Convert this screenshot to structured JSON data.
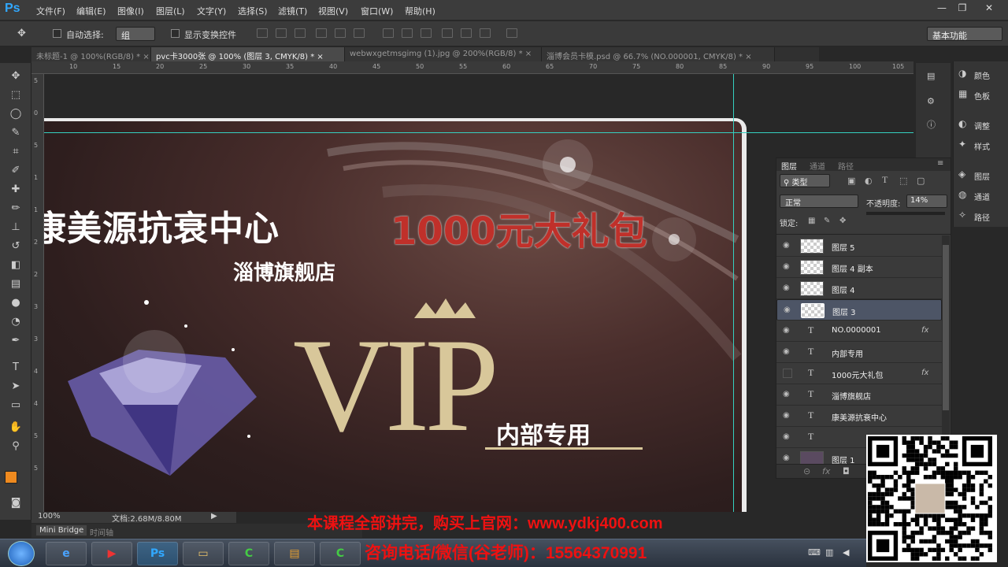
{
  "app": {
    "logo": "Ps"
  },
  "menu": [
    "文件(F)",
    "编辑(E)",
    "图像(I)",
    "图层(L)",
    "文字(Y)",
    "选择(S)",
    "滤镜(T)",
    "视图(V)",
    "窗口(W)",
    "帮助(H)"
  ],
  "window_controls": {
    "minimize": "—",
    "restore": "❐",
    "close": "✕"
  },
  "options": {
    "auto_select_label": "自动选择:",
    "auto_select_value": "组",
    "show_transform_label": "显示变换控件",
    "workspace": "基本功能"
  },
  "tabs": [
    {
      "label": "未标题-1 @ 100%(RGB/8) *",
      "close": "×"
    },
    {
      "label": "pvc卡3000张 @ 100% (图层 3, CMYK/8) *",
      "close": "×"
    },
    {
      "label": "webwxgetmsgimg (1).jpg @ 200%(RGB/8) *",
      "close": "×"
    },
    {
      "label": "淄博会员卡模.psd @ 66.7% (NO.000001, CMYK/8) *",
      "close": "×"
    }
  ],
  "ruler_top": [
    "10",
    "15",
    "20",
    "25",
    "30",
    "35",
    "40",
    "45",
    "50",
    "55",
    "60",
    "65",
    "70",
    "75",
    "80",
    "85",
    "90",
    "95",
    "100",
    "105"
  ],
  "ruler_left": [
    "5",
    "0",
    "5",
    "1",
    "1",
    "2",
    "2",
    "3",
    "3",
    "4",
    "4",
    "5",
    "5"
  ],
  "card": {
    "title": "康美源抗衰中心",
    "subtitle": "淄博旗舰店",
    "gift": "1000元大礼包",
    "vip": "VIP",
    "internal": "内部专用",
    "colors": {
      "gold": "#d8c79a",
      "red": "#c0302a",
      "bg": "#3a2624"
    }
  },
  "status": {
    "zoom": "100%",
    "doc": "文档:2.68M/8.80M"
  },
  "bottom_tabs": {
    "mini_bridge": "Mini Bridge",
    "timeline": "时间轴"
  },
  "right_panel": [
    {
      "icon": "palette-icon",
      "label": "颜色"
    },
    {
      "icon": "swatches-icon",
      "label": "色板"
    },
    {
      "icon": "adjust-icon",
      "label": "调整"
    },
    {
      "icon": "style-icon",
      "label": "样式"
    },
    {
      "icon": "layers-icon",
      "label": "图层"
    },
    {
      "icon": "channels-icon",
      "label": "通道"
    },
    {
      "icon": "paths-icon",
      "label": "路径"
    }
  ],
  "layers_panel": {
    "tabs": [
      "图层",
      "通道",
      "路径"
    ],
    "kind_filter": "类型",
    "blend_mode": "正常",
    "opacity_label": "不透明度:",
    "opacity_value": "14%",
    "lock_label": "锁定:",
    "layers": [
      {
        "name": "图层 5",
        "type": "pixel",
        "visible": true,
        "fx": false,
        "selected": false
      },
      {
        "name": "图层 4 副本",
        "type": "pixel",
        "visible": true,
        "fx": false,
        "selected": false
      },
      {
        "name": "图层 4",
        "type": "pixel",
        "visible": true,
        "fx": false,
        "selected": false
      },
      {
        "name": "图层 3",
        "type": "pixel",
        "visible": true,
        "fx": false,
        "selected": true
      },
      {
        "name": "NO.0000001",
        "type": "text",
        "visible": true,
        "fx": true,
        "selected": false
      },
      {
        "name": "内部专用",
        "type": "text",
        "visible": true,
        "fx": false,
        "selected": false
      },
      {
        "name": "1000元大礼包",
        "type": "text",
        "visible": false,
        "fx": true,
        "selected": false
      },
      {
        "name": "淄博旗舰店",
        "type": "text",
        "visible": true,
        "fx": false,
        "selected": false
      },
      {
        "name": "康美源抗衰中心",
        "type": "text",
        "visible": true,
        "fx": false,
        "selected": false
      },
      {
        "name": "",
        "type": "text",
        "visible": true,
        "fx": false,
        "selected": false
      },
      {
        "name": "图层 1",
        "type": "image",
        "visible": true,
        "fx": false,
        "selected": false
      }
    ],
    "fx_glyph": "fx"
  },
  "promo": {
    "line1": "本课程全部讲完，购买上官网：www.ydkj400.com",
    "line2": "咨询电话/微信(谷老师)：15564370991"
  }
}
